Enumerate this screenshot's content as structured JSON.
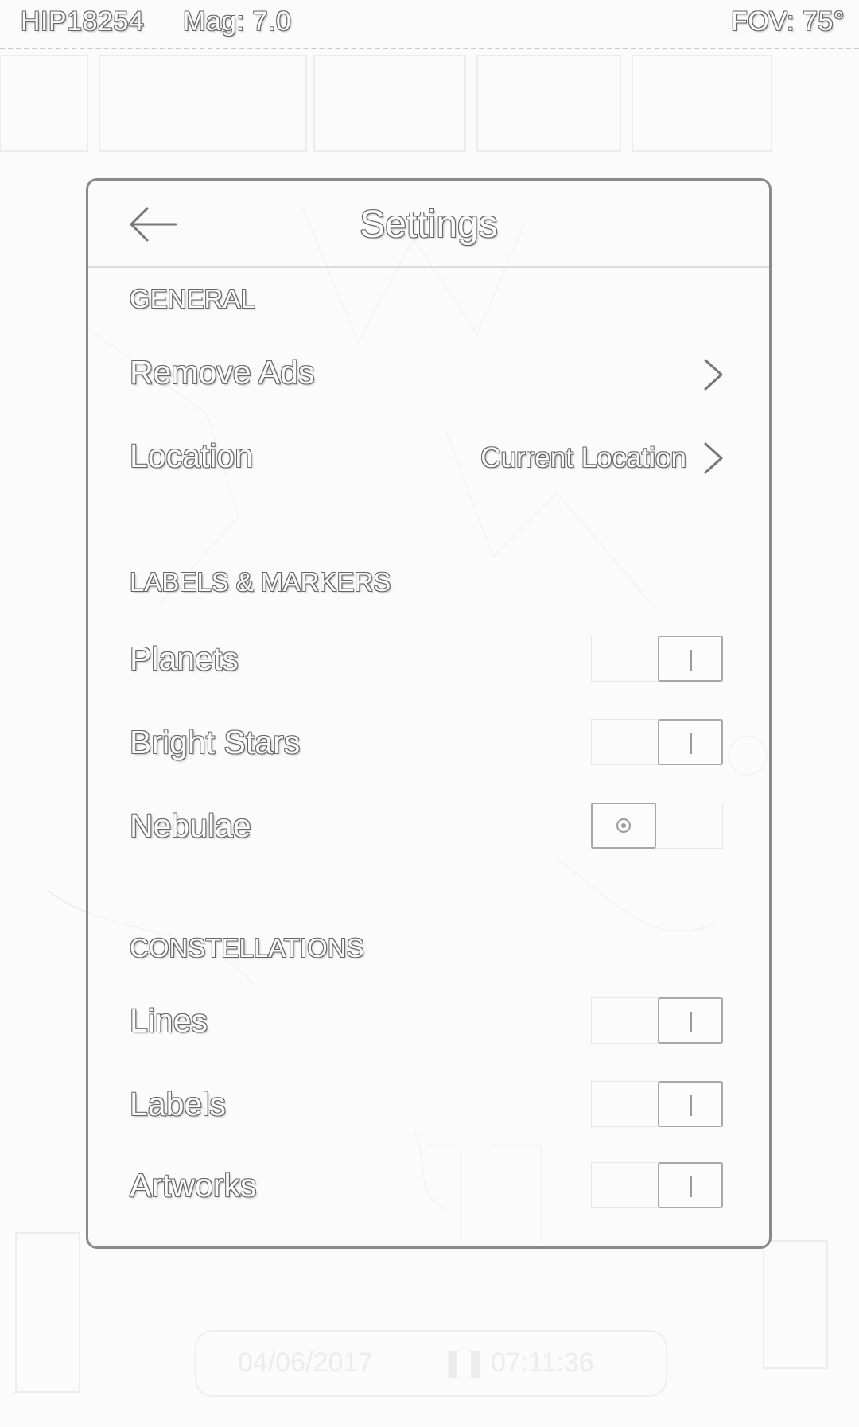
{
  "topbar": {
    "star_id": "HIP18254",
    "magnitude": "Mag: 7.0",
    "fov": "FOV: 75°"
  },
  "dialog": {
    "title": "Settings",
    "back_icon": "back-arrow-icon",
    "sections": {
      "general": {
        "header": "GENERAL",
        "remove_ads": {
          "label": "Remove Ads",
          "icon": "chevron-right-icon"
        },
        "location": {
          "label": "Location",
          "value": "Current Location",
          "icon": "chevron-right-icon"
        }
      },
      "labels_markers": {
        "header": "LABELS & MARKERS",
        "planets": {
          "label": "Planets",
          "on": true
        },
        "bright_stars": {
          "label": "Bright Stars",
          "on": true
        },
        "nebulae": {
          "label": "Nebulae",
          "on": false
        }
      },
      "constellations": {
        "header": "CONSTELLATIONS",
        "lines": {
          "label": "Lines",
          "on": true
        },
        "labels": {
          "label": "Labels",
          "on": true
        },
        "artworks": {
          "label": "Artworks",
          "on": true
        }
      }
    }
  },
  "bottom_bar": {
    "date": "04/06/2017",
    "time": "07:11:36"
  },
  "colors": {
    "background": "#fbfbfb",
    "outline": "#666666"
  }
}
